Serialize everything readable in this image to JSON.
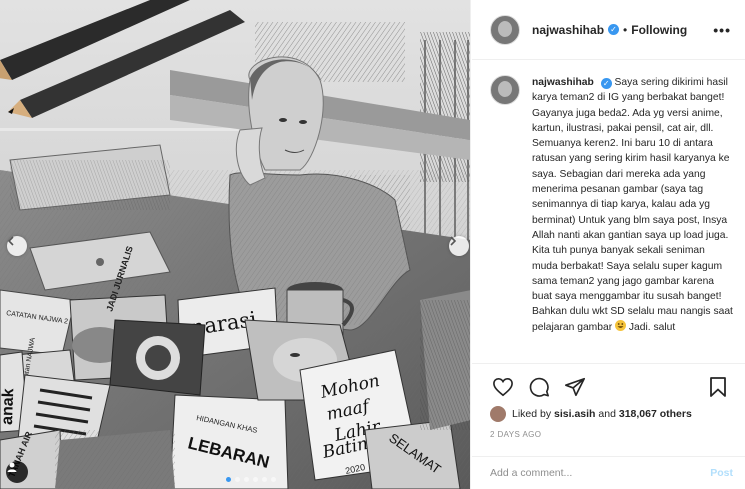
{
  "post": {
    "author": {
      "username": "najwashihab",
      "verified": true,
      "follow_status": "Following",
      "separator": "•"
    },
    "caption": "Saya sering dikirimi hasil karya teman2 di IG yang berbakat banget! Gayanya juga beda2. Ada yg versi anime, kartun, ilustrasi, pakai pensil, cat air, dll. Semuanya keren2. Ini baru 10 di antara ratusan yang sering kirim hasil karyanya ke saya. Sebagian dari mereka ada yang menerima pesanan gambar (saya tag senimannya di tiap karya, kalau ada yg berminat) Untuk yang blm saya post, Insya Allah nanti akan gantian saya up load juga. Kita tuh punya banyak sekali seniman muda berbakat! Saya selalu super kagum sama teman2 yang jago gambar karena buat saya menggambar itu susah banget! Bahkan dulu wkt SD selalu mau nangis saat pelajaran gambar",
    "caption_tail": "Jadi. salut",
    "caption_emoji": "grinning-face-emoji",
    "likes": {
      "prefix": "Liked by",
      "first_liker": "sisi.asih",
      "connector": "and",
      "others": "318,067 others"
    },
    "timestamp": "2 DAYS AGO",
    "carousel": {
      "slides": 6,
      "active": 0
    }
  },
  "artwork_text": {
    "book1": "CATATAN NAJWA 2",
    "book2": "JADI JURNALIS",
    "sticker": "narasi",
    "book3": "Catatan NAJWA",
    "book4": "anak",
    "book5": "TANAH AIR",
    "recipe": "HIDANGAN KHAS",
    "recipe2": "LEBARAN",
    "note1": "Mohon",
    "note2": "maaf",
    "note3": "Lahir",
    "note4": "Batin",
    "note_year": "2020",
    "card": "SELAMAT"
  },
  "header": {
    "more_label": "•••"
  },
  "comment": {
    "placeholder": "Add a comment...",
    "post_label": "Post"
  },
  "icons": {
    "like": "heart-icon",
    "comment": "comment-icon",
    "share": "share-icon",
    "save": "bookmark-icon",
    "prev": "chevron-left-icon",
    "next": "chevron-right-icon",
    "tag": "user-tag-icon"
  },
  "colors": {
    "accent": "#3897f0",
    "post_disabled": "#b2dffc",
    "text": "#262626",
    "muted": "#8e8e8e"
  }
}
